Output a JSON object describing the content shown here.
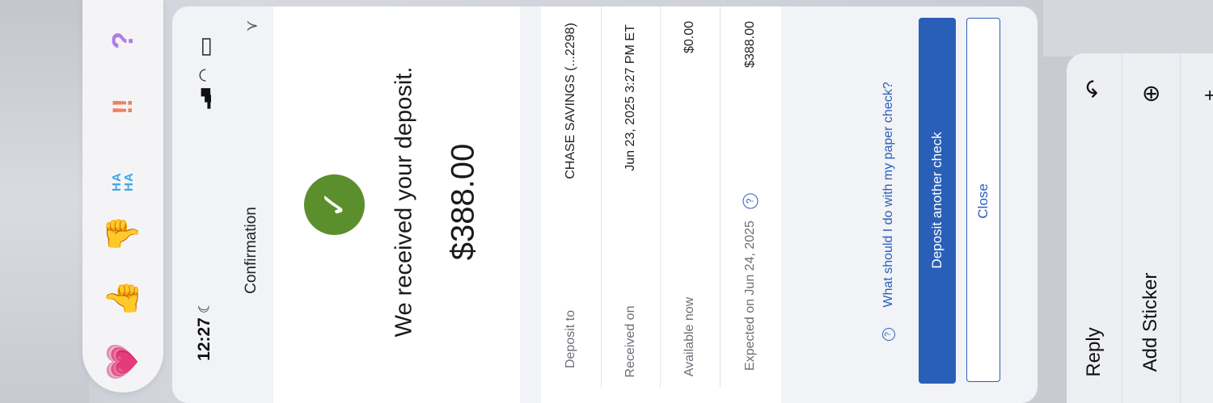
{
  "reactions": [
    {
      "name": "heart-reaction-icon",
      "glyph": "💗"
    },
    {
      "name": "thumbs-up-reaction-icon",
      "glyph": "👍"
    },
    {
      "name": "thumbs-down-reaction-icon",
      "glyph": "👎"
    },
    {
      "name": "haha-reaction-icon",
      "glyph": "HA HA"
    },
    {
      "name": "exclamation-reaction-icon",
      "glyph": "‼"
    },
    {
      "name": "question-reaction-icon",
      "glyph": "?"
    }
  ],
  "status_bar": {
    "time": "12:27",
    "moon_glyph": "☾",
    "signal_glyph": "▂▄▆",
    "wifi_glyph": "◠",
    "battery_glyph": "▭"
  },
  "header": {
    "title": "Confirmation",
    "share_icon": "⋎"
  },
  "confirmation": {
    "check_glyph": "✓",
    "message": "We received your deposit.",
    "amount": "$388.00"
  },
  "details": {
    "rows": [
      {
        "label": "Deposit to",
        "value": "CHASE SAVINGS (...2298)"
      },
      {
        "label": "Received on",
        "value": "Jun 23, 2025 3:27 PM ET"
      },
      {
        "label": "Available now",
        "value": "$0.00"
      },
      {
        "label": "Expected on Jun 24, 2025",
        "value": "$388.00",
        "info_icon": "?"
      }
    ]
  },
  "help_link": {
    "icon": "?",
    "text": "What should I do with my paper check?"
  },
  "buttons": {
    "deposit_another": "Deposit another check",
    "close": "Close"
  },
  "context_menu": {
    "reply_label": "Reply",
    "reply_icon": "↶",
    "add_sticker_label": "Add Sticker",
    "add_sticker_icon": "⊕",
    "next_icon": "+"
  },
  "colors": {
    "primary": "#2a5fb8",
    "success": "#5b8f2e",
    "link": "#2a5fb8"
  }
}
